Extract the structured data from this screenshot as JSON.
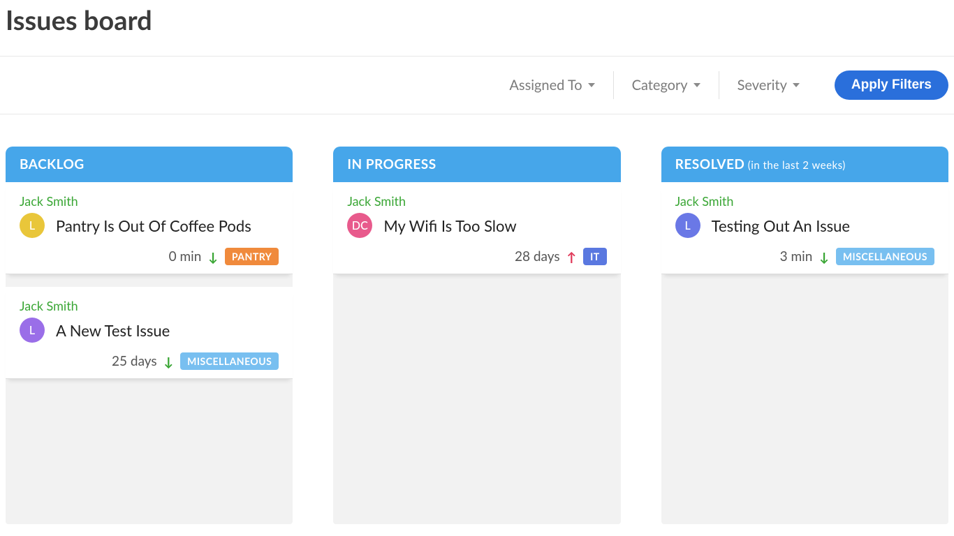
{
  "header": {
    "title": "Issues board"
  },
  "filters": {
    "assigned_to": "Assigned To",
    "category": "Category",
    "severity": "Severity",
    "apply": "Apply Filters"
  },
  "columns": [
    {
      "title": "BACKLOG",
      "subtitle": "",
      "cards": [
        {
          "reporter": "Jack Smith",
          "title": "Pantry Is Out Of Coffee Pods",
          "avatar_initials": "L",
          "avatar_color": "#e9c63a",
          "age": "0 min",
          "arrow": "down",
          "tag": "PANTRY",
          "tag_color": "#f08a3c"
        },
        {
          "reporter": "Jack Smith",
          "title": "A New Test Issue",
          "avatar_initials": "L",
          "avatar_color": "#9a6ee8",
          "age": "25 days",
          "arrow": "down",
          "tag": "MISCELLANEOUS",
          "tag_color": "#78bff0"
        }
      ]
    },
    {
      "title": "IN PROGRESS",
      "subtitle": "",
      "cards": [
        {
          "reporter": "Jack Smith",
          "title": "My Wifi Is Too Slow",
          "avatar_initials": "DC",
          "avatar_color": "#e85a8c",
          "age": "28 days",
          "arrow": "up",
          "tag": "IT",
          "tag_color": "#5a78e0"
        }
      ]
    },
    {
      "title": "RESOLVED",
      "subtitle": "(in the last 2 weeks)",
      "cards": [
        {
          "reporter": "Jack Smith",
          "title": "Testing Out An Issue",
          "avatar_initials": "L",
          "avatar_color": "#6a78e6",
          "age": "3 min",
          "arrow": "down",
          "tag": "MISCELLANEOUS",
          "tag_color": "#78bff0"
        }
      ]
    }
  ]
}
